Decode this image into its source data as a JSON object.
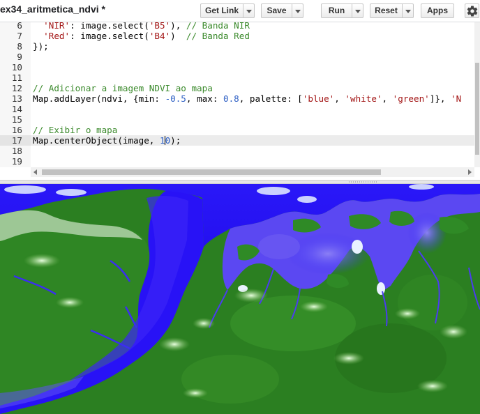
{
  "toolbar": {
    "file_title": "ex34_aritmetica_ndvi *",
    "get_link_label": "Get Link",
    "save_label": "Save",
    "run_label": "Run",
    "reset_label": "Reset",
    "apps_label": "Apps",
    "settings_icon": "gear-icon"
  },
  "editor": {
    "line_numbers": [
      "6",
      "7",
      "8",
      "9",
      "10",
      "11",
      "12",
      "13",
      "14",
      "15",
      "16",
      "17",
      "18",
      "19"
    ],
    "line6": {
      "key": "'NIR'",
      "mid": ": image.select(",
      "arg": "'B5'",
      "end": "), ",
      "comment": "// Banda NIR"
    },
    "line7": {
      "key": "'Red'",
      "mid": ": image.select(",
      "arg": "'B4'",
      "end": ")  ",
      "comment": "// Banda Red"
    },
    "line8": "});",
    "line12_comment": "// Adicionar a imagem NDVI ao mapa",
    "line13": {
      "p1": "Map.addLayer(ndvi, {min: ",
      "min": "-0.5",
      "p2": ", max: ",
      "max": "0.8",
      "p3": ", palette: [",
      "c1": "'blue'",
      "sep1": ", ",
      "c2": "'white'",
      "sep2": ", ",
      "c3": "'green'",
      "p4": "]}, ",
      "trail": "'N"
    },
    "line16_comment": "// Exibir o mapa",
    "line17": {
      "p1": "Map.centerObject(image, ",
      "zoom_a": "1",
      "zoom_b": "0",
      "p2": ");"
    },
    "active_line": "17"
  },
  "map": {
    "layer_palette": [
      "#0000ff",
      "#ffffff",
      "#2b7f21"
    ],
    "water_color": "#1f10f5",
    "vegetation_color": "#2b7f21"
  }
}
